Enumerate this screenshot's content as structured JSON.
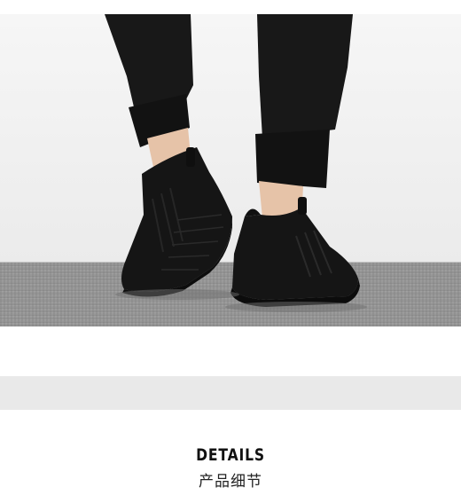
{
  "photo": {
    "icon": "sneakers-photo",
    "colors": {
      "wall": "#f3f3f3",
      "floor": "#8e8e8e",
      "pants": "#161616",
      "shoe": "#141414",
      "skin": "#e8c7ad"
    }
  },
  "details": {
    "title": "DETAILS",
    "subtitle": "产品细节"
  }
}
